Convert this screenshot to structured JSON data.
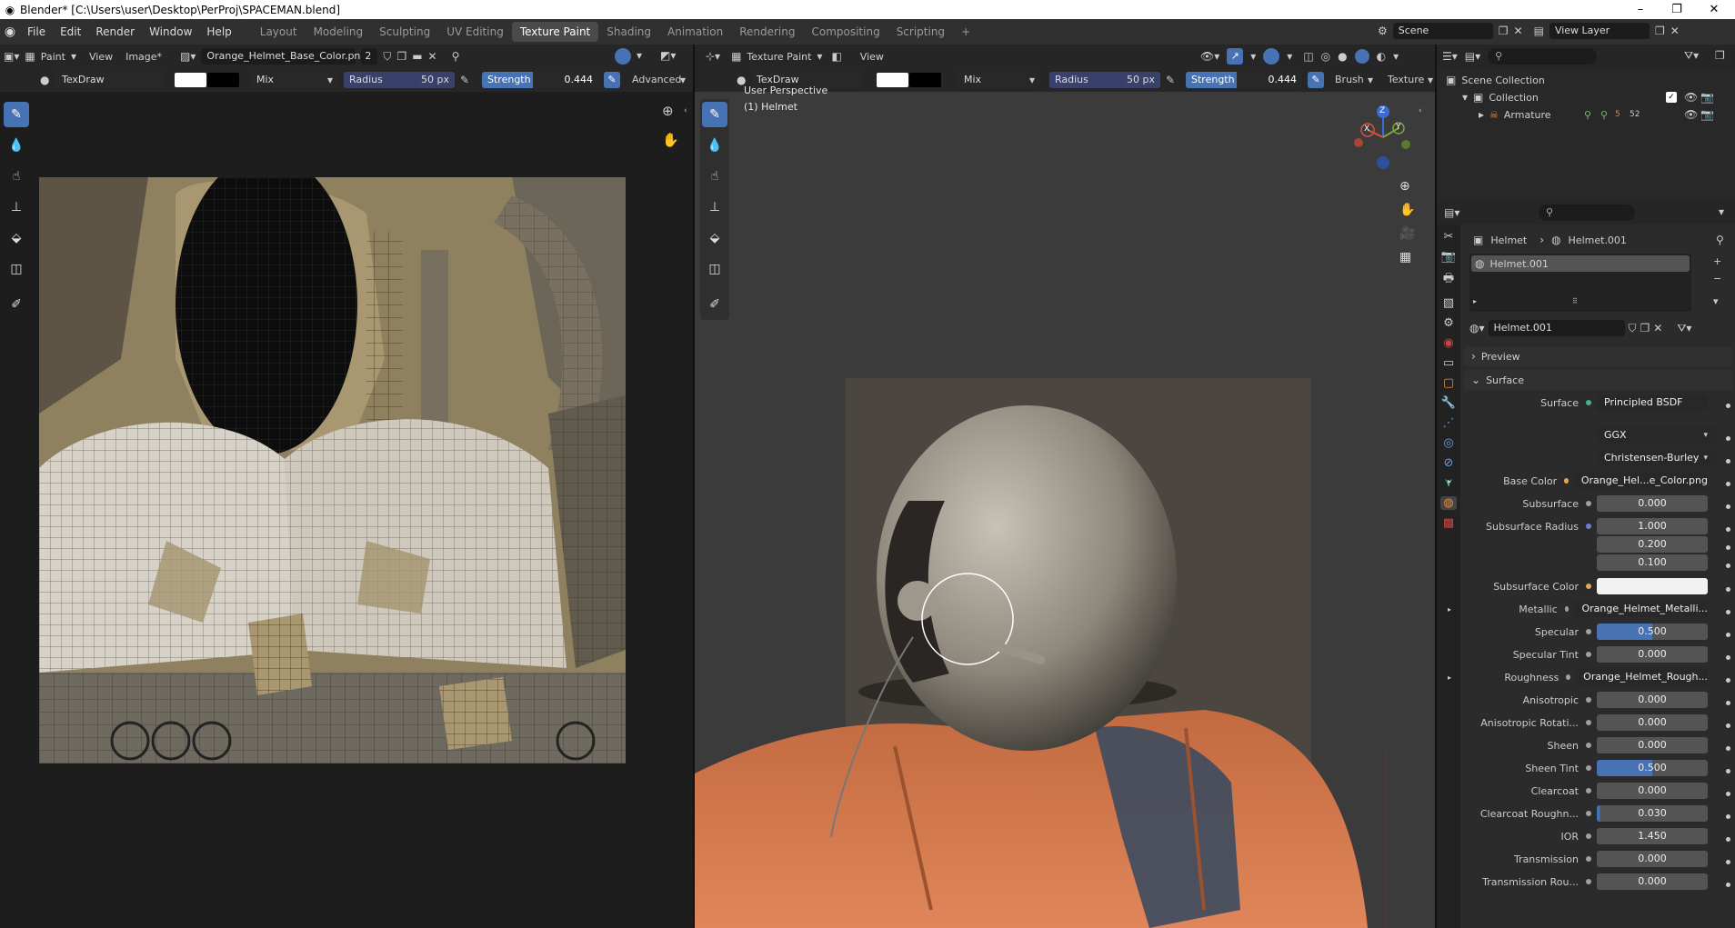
{
  "window": {
    "title": "Blender* [C:\\Users\\user\\Desktop\\PerProj\\SPACEMAN.blend]",
    "controls": [
      "–",
      "❐",
      "✕"
    ]
  },
  "menu": [
    "File",
    "Edit",
    "Render",
    "Window",
    "Help"
  ],
  "workspaces": [
    "Layout",
    "Modeling",
    "Sculpting",
    "UV Editing",
    "Texture Paint",
    "Shading",
    "Animation",
    "Rendering",
    "Compositing",
    "Scripting",
    "+"
  ],
  "active_workspace": "Texture Paint",
  "scene": {
    "label": "Scene",
    "view_layer": "View Layer"
  },
  "image_editor": {
    "mode": "Paint",
    "view": "View",
    "image_menu": "Image*",
    "image_name": "Orange_Helmet_Base_Color.png",
    "users": "2",
    "brush": "TexDraw",
    "blend": "Mix",
    "radius_label": "Radius",
    "radius_value": "50 px",
    "strength_label": "Strength",
    "strength_value": "0.444",
    "advanced": "Advanced"
  },
  "viewport": {
    "mode": "Texture Paint",
    "view": "View",
    "brush": "TexDraw",
    "blend": "Mix",
    "radius_label": "Radius",
    "radius_value": "50 px",
    "strength_label": "Strength",
    "strength_value": "0.444",
    "brush_menu": "Brush",
    "texture_menu": "Texture",
    "perspective": "User Perspective",
    "object": "(1) Helmet",
    "gizmo": {
      "x": "X",
      "y": "Y",
      "z": "Z"
    }
  },
  "outliner": {
    "scene_collection": "Scene Collection",
    "collection": "Collection",
    "armature": "Armature",
    "armature_count_a": "5",
    "armature_count_b": "52"
  },
  "properties": {
    "breadcrumb_object": "Helmet",
    "breadcrumb_material": "Helmet.001",
    "slot": "Helmet.001",
    "material_name": "Helmet.001",
    "preview": "Preview",
    "surface_panel": "Surface",
    "rows": [
      {
        "label": "Surface",
        "value": "Principled BSDF",
        "style": "dark",
        "dot": "#3fb58f"
      },
      {
        "label": "",
        "value": "GGX",
        "style": "dark",
        "dot": ""
      },
      {
        "label": "",
        "value": "Christensen-Burley",
        "style": "dark",
        "dot": ""
      },
      {
        "label": "Base Color",
        "value": "Orange_Hel...e_Color.png",
        "style": "dark",
        "dot": "#e5a55c"
      },
      {
        "label": "Subsurface",
        "value": "0.000",
        "style": "",
        "dot": "#a0a0a0"
      },
      {
        "label": "Subsurface Radius",
        "value": "1.000",
        "style": "",
        "dot": "#6c7fd8"
      },
      {
        "label": "",
        "value": "0.200",
        "style": "",
        "dot": ""
      },
      {
        "label": "",
        "value": "0.100",
        "style": "",
        "dot": ""
      },
      {
        "label": "Subsurface Color",
        "value": "",
        "style": "white",
        "dot": "#e5a55c"
      },
      {
        "label": "Metallic",
        "value": "Orange_Helmet_Metalli...",
        "style": "dark",
        "dot": "#a0a0a0"
      },
      {
        "label": "Specular",
        "value": "0.500",
        "style": "hl",
        "dot": "#a0a0a0"
      },
      {
        "label": "Specular Tint",
        "value": "0.000",
        "style": "",
        "dot": "#a0a0a0"
      },
      {
        "label": "Roughness",
        "value": "Orange_Helmet_Rough...",
        "style": "dark",
        "dot": "#a0a0a0"
      },
      {
        "label": "Anisotropic",
        "value": "0.000",
        "style": "",
        "dot": "#a0a0a0"
      },
      {
        "label": "Anisotropic Rotati...",
        "value": "0.000",
        "style": "",
        "dot": "#a0a0a0"
      },
      {
        "label": "Sheen",
        "value": "0.000",
        "style": "",
        "dot": "#a0a0a0"
      },
      {
        "label": "Sheen Tint",
        "value": "0.500",
        "style": "hl",
        "dot": "#a0a0a0"
      },
      {
        "label": "Clearcoat",
        "value": "0.000",
        "style": "",
        "dot": "#a0a0a0"
      },
      {
        "label": "Clearcoat Roughn...",
        "value": "0.030",
        "style": "",
        "dot": "#a0a0a0"
      },
      {
        "label": "IOR",
        "value": "1.450",
        "style": "",
        "dot": "#a0a0a0"
      },
      {
        "label": "Transmission",
        "value": "0.000",
        "style": "",
        "dot": "#a0a0a0"
      },
      {
        "label": "Transmission Rou...",
        "value": "0.000",
        "style": "",
        "dot": "#a0a0a0"
      }
    ]
  },
  "colors": {
    "accent": "#4772b3",
    "bg": "#1d1d1d",
    "panel": "#303030"
  }
}
